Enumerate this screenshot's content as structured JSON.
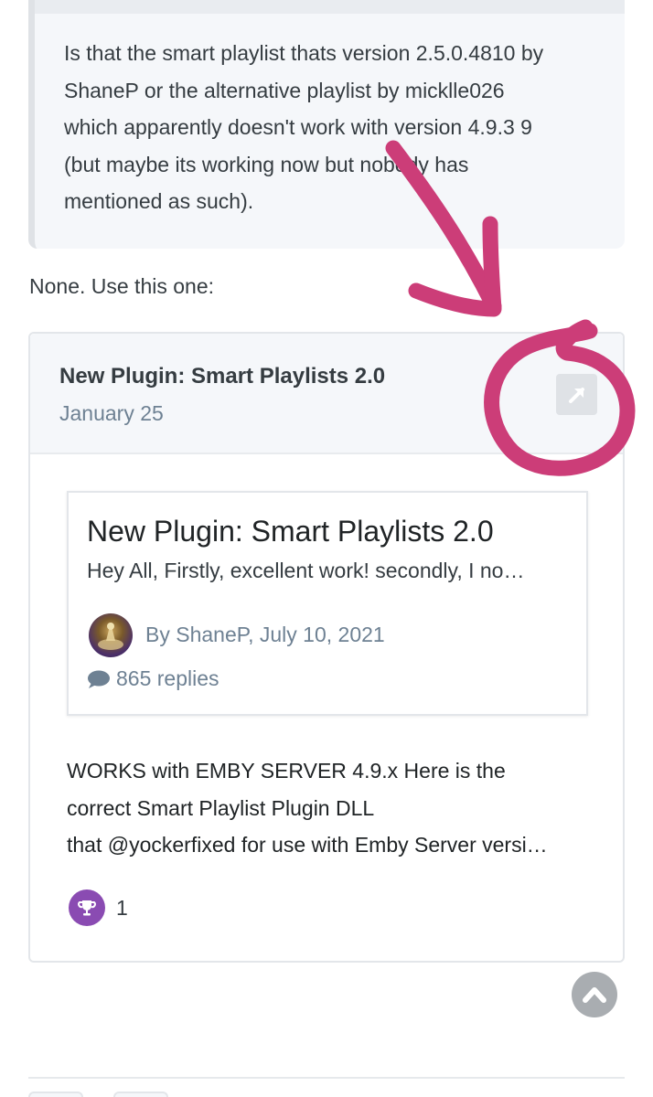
{
  "quote": {
    "lines": [
      "Is that the smart playlist thats version 2.5.0.4810 by",
      "ShaneP or the alternative playlist by micklle026",
      "which apparently doesn't work with version 4.9.3 9",
      "(but maybe its working now but nobody has",
      "mentioned as such)."
    ]
  },
  "reply": {
    "text": "None. Use this one:"
  },
  "embed": {
    "title": "New Plugin: Smart Playlists 2.0",
    "date": "January 25",
    "open_icon": "external-link-icon",
    "card": {
      "title": "New Plugin: Smart Playlists 2.0",
      "snippet": "Hey All,   Firstly, excellent work! secondly, I no…",
      "byline": "By ShaneP, July 10, 2021",
      "replies": "865 replies"
    },
    "body": {
      "lines": [
        "WORKS with EMBY SERVER 4.9.x Here is the",
        "correct Smart Playlist Plugin DLL",
        "that @yockerfixed for use with Emby Server versi…"
      ]
    },
    "reaction": {
      "icon": "trophy-icon",
      "count": "1"
    }
  },
  "colors": {
    "annotation": "#cc3d78",
    "reaction_badge": "#8a4bb2",
    "muted_text": "#6e8193"
  }
}
